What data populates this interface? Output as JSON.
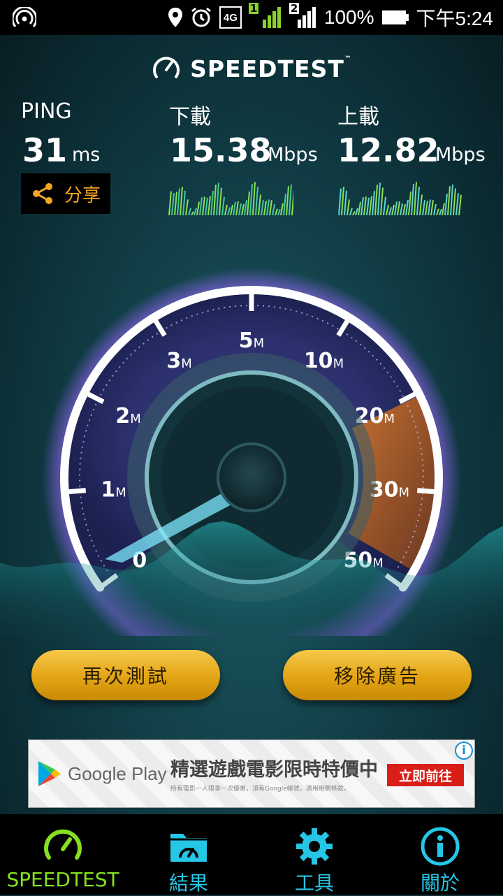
{
  "status_bar": {
    "network_type": "4G",
    "sim1": "1",
    "sim2": "2",
    "battery": "100%",
    "time": "下午5:24"
  },
  "app": {
    "brand": "SPEEDTEST",
    "trademark": "™"
  },
  "metrics": {
    "ping": {
      "label": "PING",
      "value": "31",
      "unit": "ms"
    },
    "download": {
      "label": "下載",
      "value": "15.38",
      "unit": "Mbps"
    },
    "upload": {
      "label": "上載",
      "value": "12.82",
      "unit": "Mbps"
    }
  },
  "share": {
    "label": "分享",
    "icon": "share-icon"
  },
  "gauge": {
    "ticks": [
      {
        "num": "0",
        "unit": ""
      },
      {
        "num": "1",
        "unit": "M"
      },
      {
        "num": "2",
        "unit": "M"
      },
      {
        "num": "3",
        "unit": "M"
      },
      {
        "num": "5",
        "unit": "M"
      },
      {
        "num": "10",
        "unit": "M"
      },
      {
        "num": "20",
        "unit": "M"
      },
      {
        "num": "30",
        "unit": "M"
      },
      {
        "num": "50",
        "unit": "M"
      }
    ],
    "colors": {
      "ring": "#ffffff",
      "accent_purple": "#9b6cf2",
      "accent_orange": "#f08a24",
      "needle": "#7fe9ff"
    }
  },
  "buttons": {
    "retest": "再次測試",
    "remove_ads": "移除廣告"
  },
  "ad": {
    "store": "Google Play",
    "headline": "精選遊戲電影限時特價中",
    "fine_print": "所有電影一人限享一次優惠，須有Google帳號，適用相關條款。",
    "cta": "立即前往",
    "info": "i"
  },
  "nav": {
    "items": [
      {
        "label": "SPEEDTEST",
        "icon": "speedometer-icon",
        "active": true
      },
      {
        "label": "結果",
        "icon": "results-folder-icon",
        "active": false
      },
      {
        "label": "工具",
        "icon": "gear-icon",
        "active": false
      },
      {
        "label": "關於",
        "icon": "info-icon",
        "active": false
      }
    ],
    "colors": {
      "active": "#86e01e",
      "inactive": "#26c6e6"
    }
  }
}
